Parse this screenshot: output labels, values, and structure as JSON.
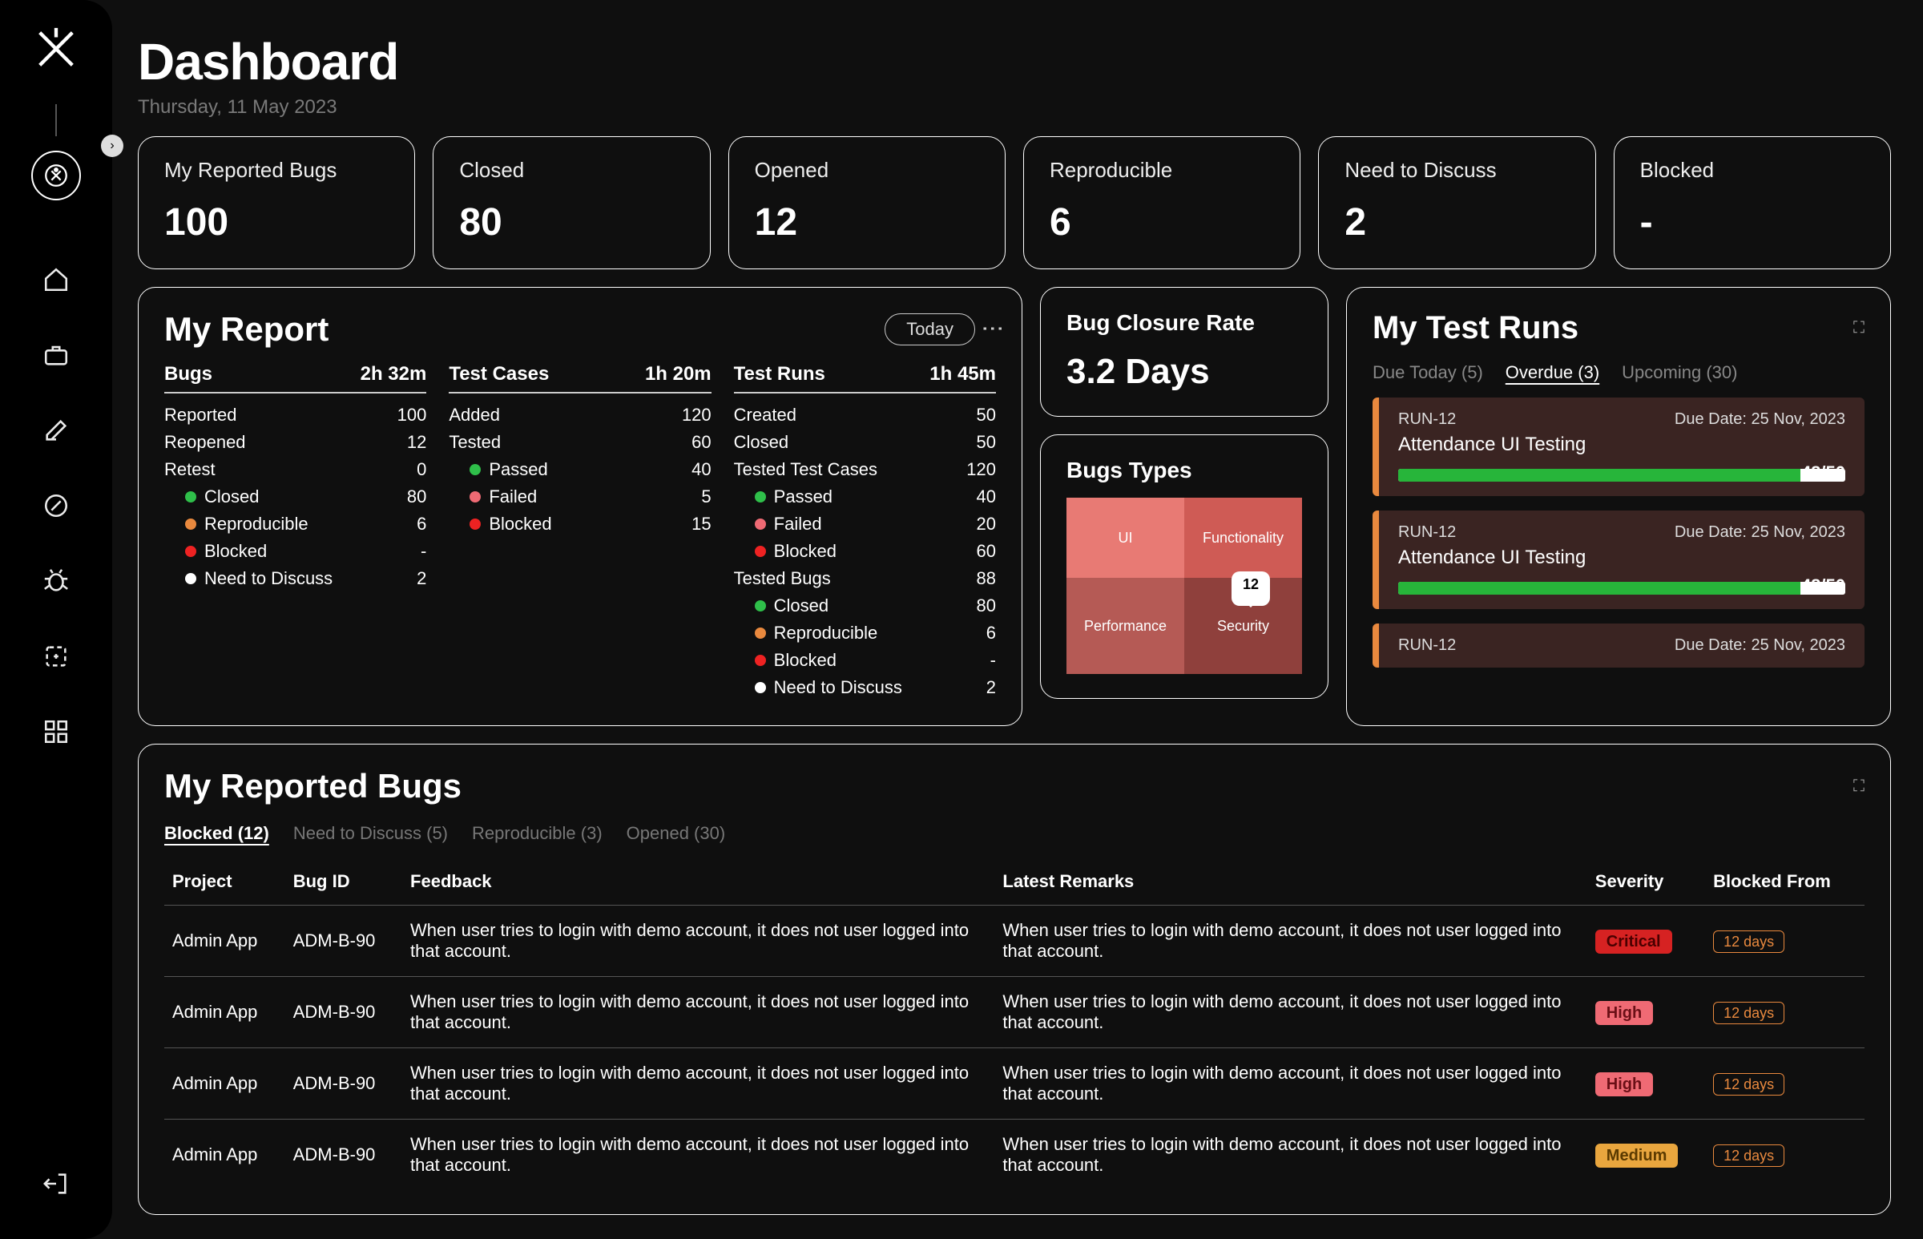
{
  "header": {
    "title": "Dashboard",
    "date": "Thursday, 11 May 2023"
  },
  "kpis": [
    {
      "label": "My Reported Bugs",
      "value": "100"
    },
    {
      "label": "Closed",
      "value": "80"
    },
    {
      "label": "Opened",
      "value": "12"
    },
    {
      "label": "Reproducible",
      "value": "6"
    },
    {
      "label": "Need to Discuss",
      "value": "2"
    },
    {
      "label": "Blocked",
      "value": "-"
    }
  ],
  "my_report": {
    "title": "My Report",
    "filter": "Today",
    "columns": {
      "bugs": {
        "heading": "Bugs",
        "duration": "2h 32m",
        "rows": [
          {
            "label": "Reported",
            "value": "100"
          },
          {
            "label": "Reopened",
            "value": "12"
          },
          {
            "label": "Retest",
            "value": "0"
          },
          {
            "label": "Closed",
            "value": "80",
            "dot": "green",
            "indent": true
          },
          {
            "label": "Reproducible",
            "value": "6",
            "dot": "orange",
            "indent": true
          },
          {
            "label": "Blocked",
            "value": "-",
            "dot": "red",
            "indent": true
          },
          {
            "label": "Need to Discuss",
            "value": "2",
            "dot": "white",
            "indent": true
          }
        ]
      },
      "testcases": {
        "heading": "Test Cases",
        "duration": "1h 20m",
        "rows": [
          {
            "label": "Added",
            "value": "120"
          },
          {
            "label": "Tested",
            "value": "60"
          },
          {
            "label": "Passed",
            "value": "40",
            "dot": "green",
            "indent": true
          },
          {
            "label": "Failed",
            "value": "5",
            "dot": "pink",
            "indent": true
          },
          {
            "label": "Blocked",
            "value": "15",
            "dot": "red",
            "indent": true
          }
        ]
      },
      "testruns": {
        "heading": "Test Runs",
        "duration": "1h 45m",
        "rows": [
          {
            "label": "Created",
            "value": "50"
          },
          {
            "label": "Closed",
            "value": "50"
          },
          {
            "label": "Tested Test Cases",
            "value": "120"
          },
          {
            "label": "Passed",
            "value": "40",
            "dot": "green",
            "indent": true
          },
          {
            "label": "Failed",
            "value": "20",
            "dot": "pink",
            "indent": true
          },
          {
            "label": "Blocked",
            "value": "60",
            "dot": "red",
            "indent": true
          },
          {
            "label": "Tested Bugs",
            "value": "88"
          },
          {
            "label": "Closed",
            "value": "80",
            "dot": "green",
            "indent": true
          },
          {
            "label": "Reproducible",
            "value": "6",
            "dot": "orange",
            "indent": true
          },
          {
            "label": "Blocked",
            "value": "-",
            "dot": "red",
            "indent": true
          },
          {
            "label": "Need to Discuss",
            "value": "2",
            "dot": "white",
            "indent": true
          }
        ]
      }
    }
  },
  "bug_closure": {
    "title": "Bug Closure Rate",
    "value": "3.2 Days"
  },
  "bug_types": {
    "title": "Bugs Types",
    "cells": {
      "ui": "UI",
      "func": "Functionality",
      "perf": "Performance",
      "sec": "Security"
    },
    "tooltip": "12"
  },
  "test_runs_panel": {
    "title": "My Test Runs",
    "tabs": [
      {
        "label": "Due Today (5)"
      },
      {
        "label": "Overdue (3)",
        "active": true
      },
      {
        "label": "Upcoming (30)"
      }
    ],
    "cards": [
      {
        "id": "RUN-12",
        "due": "Due Date: 25 Nov, 2023",
        "title": "Attendance UI Testing",
        "progress": 90,
        "count": "48/50"
      },
      {
        "id": "RUN-12",
        "due": "Due Date: 25 Nov, 2023",
        "title": "Attendance UI Testing",
        "progress": 90,
        "count": "48/50"
      }
    ],
    "mini": {
      "id": "RUN-12",
      "due": "Due Date: 25 Nov, 2023"
    }
  },
  "reported_bugs": {
    "title": "My Reported Bugs",
    "tabs": [
      {
        "label": "Blocked (12)",
        "active": true
      },
      {
        "label": "Need to Discuss (5)"
      },
      {
        "label": "Reproducible (3)"
      },
      {
        "label": "Opened (30)"
      }
    ],
    "columns": [
      "Project",
      "Bug ID",
      "Feedback",
      "Latest Remarks",
      "Severity",
      "Blocked From"
    ],
    "rows": [
      {
        "project": "Admin App",
        "bug_id": "ADM-B-90",
        "feedback": "When user tries to login with demo account, it does not user logged into that account.",
        "remarks": "When user tries to login with demo account, it does not user logged into that account.",
        "severity": "Critical",
        "sev_class": "critical",
        "blocked": "12 days"
      },
      {
        "project": "Admin App",
        "bug_id": "ADM-B-90",
        "feedback": "When user tries to login with demo account, it does not user logged into that account.",
        "remarks": "When user tries to login with demo account, it does not user logged into that account.",
        "severity": "High",
        "sev_class": "high",
        "blocked": "12 days"
      },
      {
        "project": "Admin App",
        "bug_id": "ADM-B-90",
        "feedback": "When user tries to login with demo account, it does not user logged into that account.",
        "remarks": "When user tries to login with demo account, it does not user logged into that account.",
        "severity": "High",
        "sev_class": "high",
        "blocked": "12 days"
      },
      {
        "project": "Admin App",
        "bug_id": "ADM-B-90",
        "feedback": "When user tries to login with demo account, it does not user logged into that account.",
        "remarks": "When user tries to login with demo account, it does not user logged into that account.",
        "severity": "Medium",
        "sev_class": "medium",
        "blocked": "12 days"
      }
    ]
  },
  "chart_data": {
    "type": "treemap",
    "title": "Bugs Types",
    "series": [
      {
        "name": "UI",
        "value": 20
      },
      {
        "name": "Functionality",
        "value": 20
      },
      {
        "name": "Performance",
        "value": 24
      },
      {
        "name": "Security",
        "value": 12
      }
    ],
    "highlight": {
      "name": "Security",
      "value": 12
    }
  }
}
